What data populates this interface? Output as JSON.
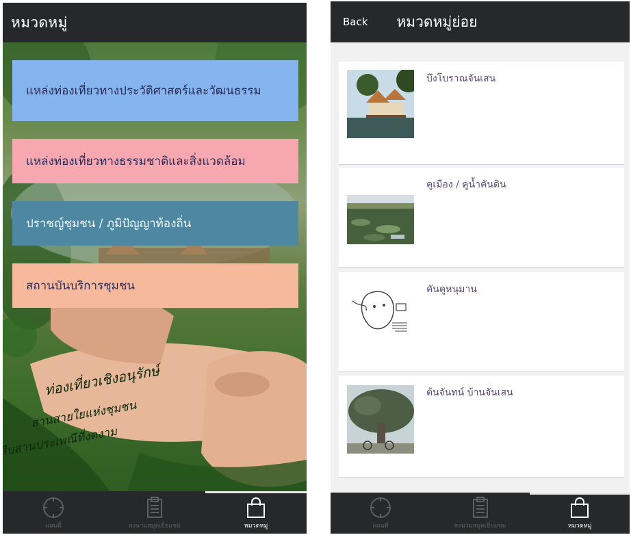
{
  "left_screen": {
    "title": "หมวดหมู่",
    "categories": [
      "แหล่งท่องเที่ยวทางประวัติศาสตร์และวัฒนธรรม",
      "แหล่งท่องเที่ยวทางธรรมชาติและสิ่งแวดล้อม",
      "ปราชญ์ชุมชน / ภูมิปัญญาท้องถิ่น",
      "สถานบันบริการชุมชน"
    ],
    "artwork_text": [
      "ท่องเที่ยวเชิงอนุรักษ์",
      "สานสายใยแห่งชุมชน",
      "สืบสานประเพณีที่งดงาม"
    ]
  },
  "right_screen": {
    "back_label": "Back",
    "title": "หมวดหมู่ย่อย",
    "items": [
      {
        "name": "บึงโบราณจันเสน",
        "thumb": "temple-pavilion-photo"
      },
      {
        "name": "คูเมือง / คูน้ำคันดิน",
        "thumb": "moat-lotus-photo"
      },
      {
        "name": "คันคูหนุมาน",
        "thumb": "hanuman-sketch"
      },
      {
        "name": "ต้นจันทน์ บ้านจันเสน",
        "thumb": "big-tree-photo"
      }
    ]
  },
  "bottom_nav": [
    {
      "label": "แผนที่",
      "icon": "compass-icon",
      "active": false
    },
    {
      "label": "ลงนามสมุดเยี่ยมชม",
      "icon": "clipboard-icon",
      "active": false
    },
    {
      "label": "หมวดหมู่",
      "icon": "shopping-bag-icon",
      "active": true
    }
  ]
}
